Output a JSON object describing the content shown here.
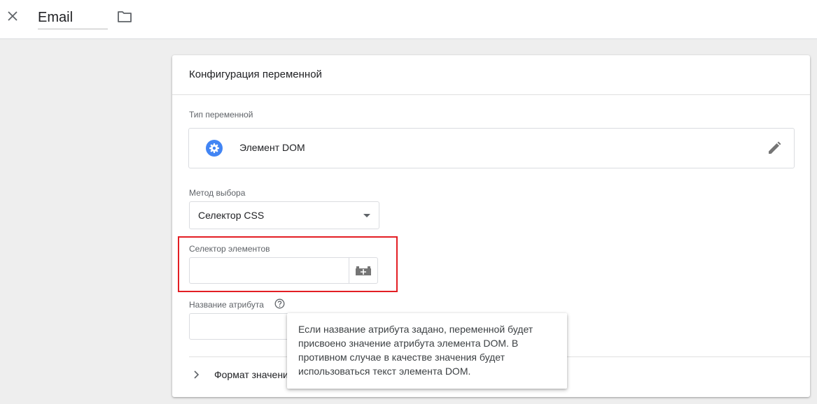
{
  "header": {
    "title_value": "Email",
    "close_icon": "close-icon",
    "folder_icon": "folder-icon"
  },
  "card": {
    "title": "Конфигурация переменной",
    "variable_type": {
      "label": "Тип переменной",
      "name": "Элемент DOM",
      "icon": "gear-icon",
      "icon_color": "#4285f4",
      "edit_icon": "pencil-icon"
    },
    "selection_method": {
      "label": "Метод выбора",
      "value": "Селектор CSS"
    },
    "element_selector": {
      "label": "Селектор элементов",
      "value": "",
      "picker_icon": "element-picker-icon",
      "highlight_color": "#e31e24"
    },
    "attribute_name": {
      "label": "Название атрибута",
      "value": "",
      "help_icon": "help-icon"
    },
    "format_section": {
      "label": "Формат значения"
    }
  },
  "tooltip": {
    "text": "Если название атрибута задано, переменной будет присвоено значение атрибута элемента DOM. В противном случае в качестве значения будет использоваться текст элемента DOM."
  }
}
